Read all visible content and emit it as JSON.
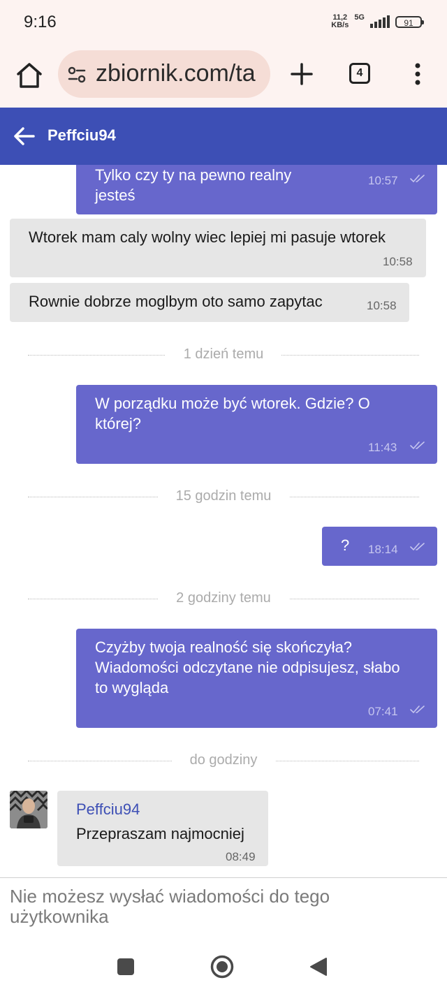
{
  "status_bar": {
    "time": "9:16",
    "net_speed_value": "11,2",
    "net_speed_unit": "KB/s",
    "network": "5G",
    "battery": "91"
  },
  "browser": {
    "url": "zbiornik.com/ta",
    "tab_count": "4",
    "icons": [
      "home-icon",
      "site-settings-icon",
      "plus-icon",
      "tabs-icon",
      "more-vert-icon"
    ]
  },
  "header": {
    "title": "Peffciu94",
    "back_icon": "arrow-left-icon",
    "color": "#3d4fb5"
  },
  "colors": {
    "outgoing_bubble": "#6767cc",
    "incoming_bubble": "#e6e6e6"
  },
  "messages": [
    {
      "direction": "out",
      "lines": [
        "Tylko czy ty na pewno realny",
        "jesteś"
      ],
      "time": "10:57",
      "read": true
    },
    {
      "direction": "in",
      "lines": [
        "Wtorek mam caly wolny wiec lepiej mi pasuje wtorek"
      ],
      "time": "10:58"
    },
    {
      "direction": "in",
      "lines": [
        "Rownie dobrze moglbym oto samo zapytac"
      ],
      "time": "10:58"
    },
    {
      "separator": "1 dzień temu"
    },
    {
      "direction": "out",
      "lines": [
        "W porządku może być wtorek. Gdzie? O",
        "której?"
      ],
      "time": "11:43",
      "read": true
    },
    {
      "separator": "15 godzin temu"
    },
    {
      "direction": "out",
      "lines": [
        "?"
      ],
      "time": "18:14",
      "read": true
    },
    {
      "separator": "2 godziny temu"
    },
    {
      "direction": "out",
      "lines": [
        "Czyżby twoja realność się skończyła?",
        "Wiadomości odczytane nie odpisujesz, słabo",
        "to wygląda"
      ],
      "time": "07:41",
      "read": true
    },
    {
      "separator": "do godziny"
    },
    {
      "direction": "in",
      "sender": "Peffciu94",
      "lines": [
        "Przepraszam najmocniej"
      ],
      "time": "08:49",
      "avatar": true
    }
  ],
  "composer": {
    "disabled_text": "Nie możesz wysłać wiadomości do tego użytkownika"
  },
  "nav_bar": {
    "icons": [
      "recents-square-icon",
      "home-circle-icon",
      "back-triangle-icon"
    ]
  }
}
